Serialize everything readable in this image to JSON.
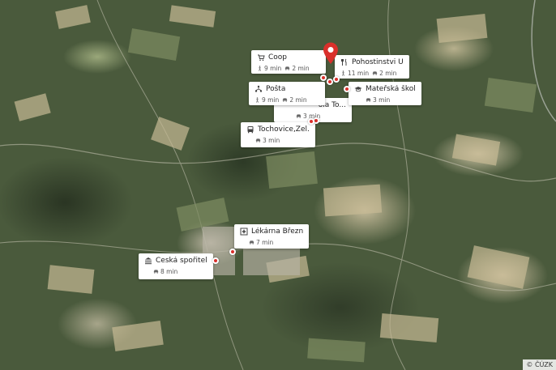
{
  "map": {
    "attribution": "© ČÚZK"
  },
  "pois": [
    {
      "id": "coop",
      "name": "Coop",
      "icon": "cart-icon",
      "walk": "9 min",
      "car": "2 min"
    },
    {
      "id": "pohostinstvi",
      "name": "Pohostinstvi U He...",
      "icon": "fork-knife-icon",
      "walk": "11 min",
      "car": "2 min"
    },
    {
      "id": "posta",
      "name": "Pošta",
      "icon": "post-office-icon",
      "walk": "9 min",
      "car": "2 min"
    },
    {
      "id": "skola",
      "name": "ola To...",
      "icon": "school-icon",
      "car": "3 min"
    },
    {
      "id": "materska",
      "name": "Mateřská škola",
      "icon": "graduation-cap-icon",
      "car": "3 min"
    },
    {
      "id": "tochovice",
      "name": "Tochovice,Žel.St.",
      "icon": "bus-icon",
      "car": "3 min"
    },
    {
      "id": "lekarna",
      "name": "Lékárna Březnice",
      "icon": "pharmacy-icon",
      "car": "7 min"
    },
    {
      "id": "sporitelna",
      "name": "Česká spořitelna",
      "icon": "bank-icon",
      "car": "8 min"
    }
  ],
  "colors": {
    "pin": "#d9302b",
    "card": "#ffffff"
  }
}
